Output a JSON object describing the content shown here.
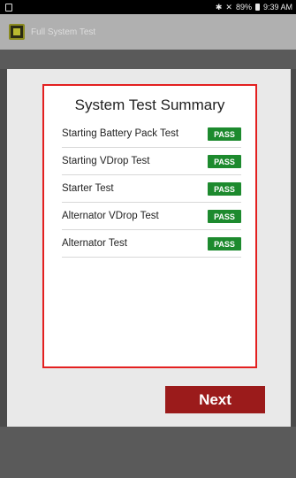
{
  "status_bar": {
    "left_icon": "sim-icon",
    "right_icons": [
      "bluetooth-icon",
      "signal-off-icon"
    ],
    "battery": "89%",
    "time": "9:39 AM"
  },
  "app_bar": {
    "title": "Full System Test",
    "app_icon": "app-icon"
  },
  "summary": {
    "title": "System Test Summary",
    "tests": [
      {
        "name": "Starting Battery Pack Test",
        "result": "PASS"
      },
      {
        "name": "Starting VDrop Test",
        "result": "PASS"
      },
      {
        "name": "Starter Test",
        "result": "PASS"
      },
      {
        "name": "Alternator VDrop Test",
        "result": "PASS"
      },
      {
        "name": "Alternator Test",
        "result": "PASS"
      }
    ]
  },
  "actions": {
    "next_label": "Next"
  },
  "colors": {
    "card_border": "#e32020",
    "pass": "#1d8a2e",
    "next_button": "#9b1b1b"
  }
}
